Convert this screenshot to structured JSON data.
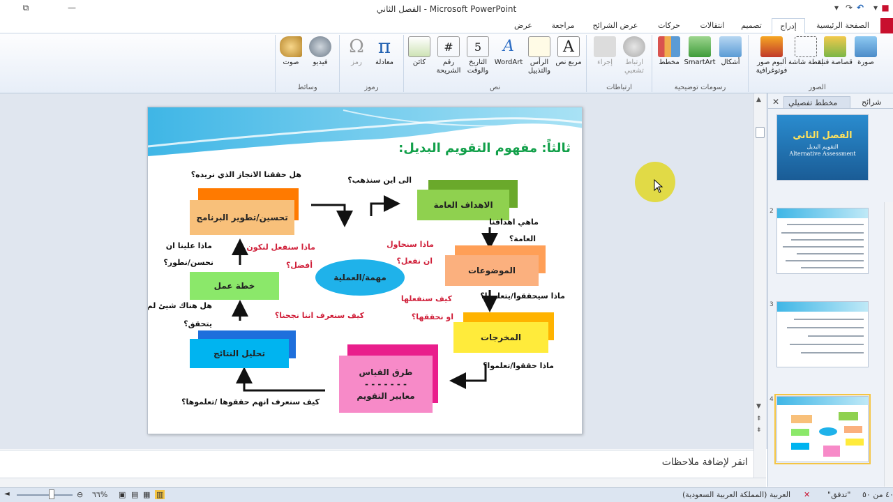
{
  "window": {
    "title": "الفصل الثاني  -  Microsoft PowerPoint"
  },
  "tabs": [
    {
      "label": "الصفحة الرئيسية"
    },
    {
      "label": "إدراج",
      "active": true
    },
    {
      "label": "تصميم"
    },
    {
      "label": "انتقالات"
    },
    {
      "label": "حركات"
    },
    {
      "label": "عرض الشرائح"
    },
    {
      "label": "مراجعة"
    },
    {
      "label": "عرض"
    }
  ],
  "ribbon": {
    "groups": {
      "images": "الصور",
      "illustrations": "رسومات توضيحية",
      "links": "ارتباطات",
      "text": "نص",
      "symbols": "رموز",
      "media": "وسائط"
    },
    "commands": {
      "picture": "صورة",
      "clipart": "قصاصة فنية",
      "screenshot": "لقطة شاشة",
      "photo_album": "ألبوم صور فوتوغرافية",
      "shapes": "أشكال",
      "smartart": "SmartArt",
      "chart": "مخطط",
      "hyperlink": "ارتباط تشعبي",
      "action": "إجراء",
      "textbox": "مربع نص",
      "header_footer": "الرأس والتذييل",
      "wordart": "WordArt",
      "date_time": "التاريخ والوقت",
      "slide_number": "رقم الشريحة",
      "object": "كائن",
      "equation": "معادلة",
      "symbol": "رمز",
      "video": "فيديو",
      "audio": "صوت"
    }
  },
  "slide": {
    "title": "ثالثاً: مفهوم التقويم البديل:",
    "boxes": {
      "improve": "تحسين/تطوير البرنامج",
      "goals": "الاهداف العامة",
      "topics": "الموضوعات",
      "outputs": "المخرجات",
      "measure": "طرق القياس",
      "dashes": "- - - - - - -",
      "criteria": "معايير التقويم",
      "analysis": "تحليل النتائج",
      "plan": "خطة عمل",
      "task": "مهمة/العملية"
    },
    "questions": {
      "q_achieved": "هل حققنا الانجاز الذي نريده؟",
      "q_where": "الى اين سنذهب؟",
      "q_goals_1": "ماهي اهدافنا",
      "q_goals_2": "العامة؟",
      "q_try_1": "ماذا سنحاول",
      "q_try_2": "ان نفعل؟",
      "q_better_1": "ماذا سنفعل لنكون",
      "q_better_2": "أفضل؟",
      "q_must_1": "ماذا علينا ان",
      "q_must_2": "نحسن/نطور؟",
      "q_learn": "ماذا سيحققوا/يتعلموا؟",
      "q_how_1": "كيف سنفعلها",
      "q_how_2": "او نحققها؟",
      "q_notyet_1": "هل هناك شيئ لم",
      "q_notyet_2": "يتحقق؟",
      "q_success": "كيف سنعرف اننا نجحنا؟",
      "q_learned": "ماذا حققوا/تعلموا؟",
      "q_know": "كيف سنعرف انهم حققوها /تعلموها؟"
    }
  },
  "notes": {
    "placeholder": "انقر لإضافة ملاحظات"
  },
  "side_panel": {
    "tab_slides": "شرائح",
    "tab_outline": "مخطط تفصيلي",
    "thumb1": {
      "title": "الفصل الثاني",
      "subtitle": "التقويم البديل",
      "english": "Alternative Assessment"
    },
    "numbers": [
      "2",
      "3",
      "4"
    ]
  },
  "status": {
    "slide_info": "٤٠ من ٥٠",
    "theme": "\"تدفق\"",
    "language": "العربية (المملكة العربية السعودية)",
    "zoom": "٦٦%"
  }
}
